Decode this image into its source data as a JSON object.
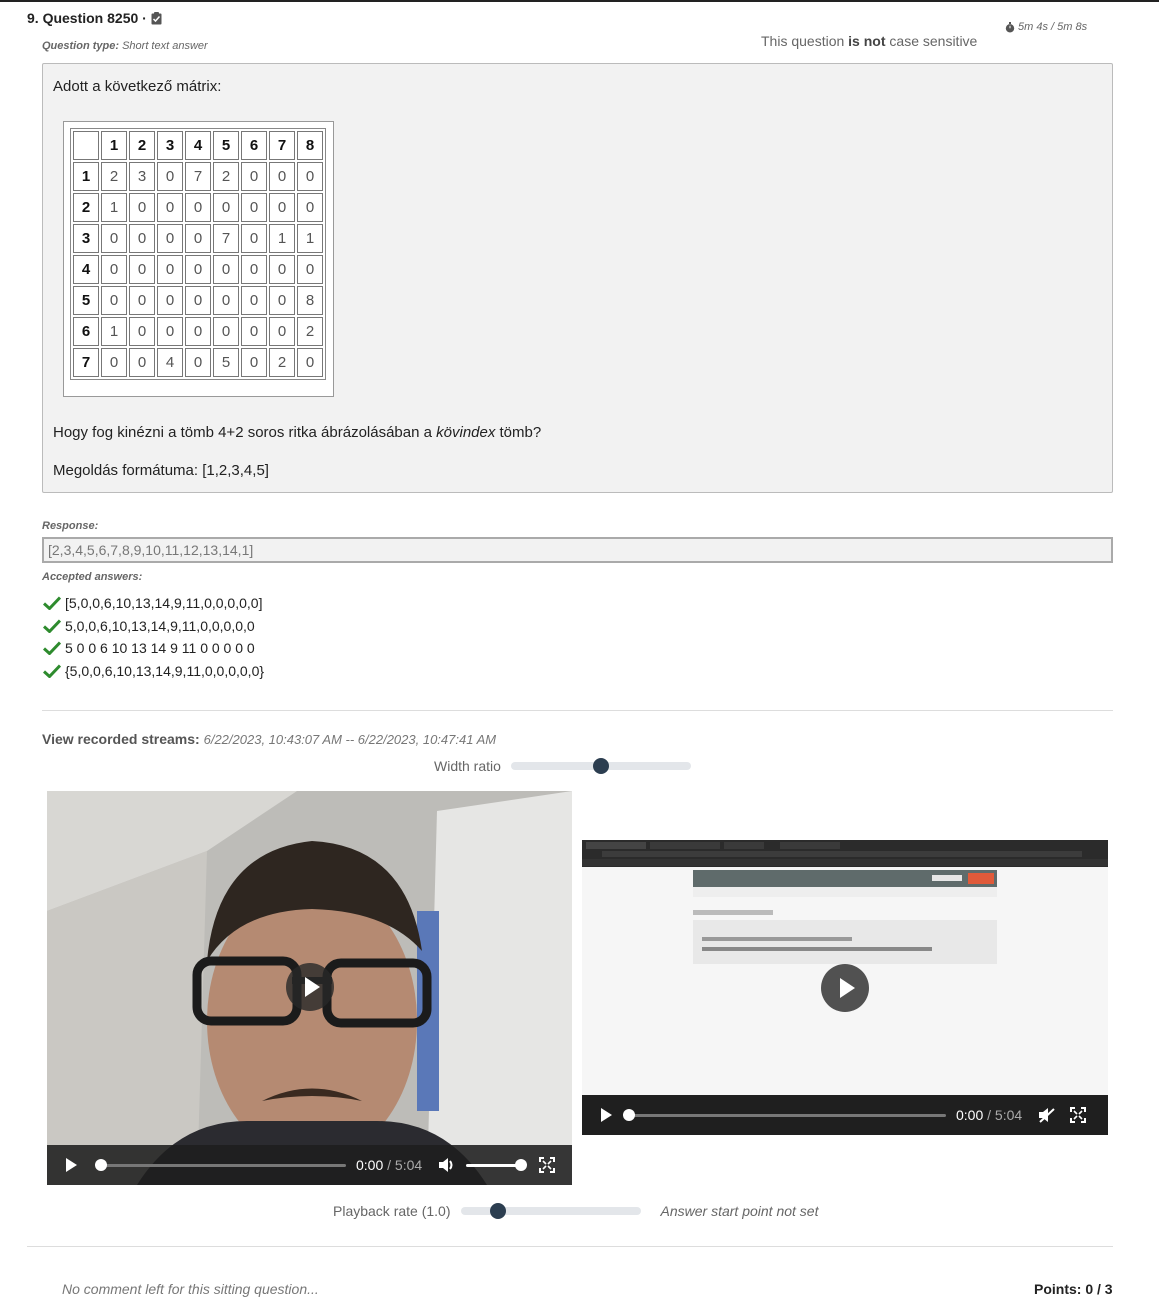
{
  "question": {
    "number_title": "9. Question 8250 ·",
    "type_label": "Question type:",
    "type_value": "Short text answer",
    "case_prefix": "This question",
    "case_strong": "is not",
    "case_suffix": "case sensitive",
    "timer": "5m 4s / 5m 8s",
    "intro": "Adott a következő mátrix:",
    "matrix": {
      "col_headers": [
        "",
        "1",
        "2",
        "3",
        "4",
        "5",
        "6",
        "7",
        "8"
      ],
      "rows": [
        [
          "1",
          "2",
          "3",
          "0",
          "7",
          "2",
          "0",
          "0",
          "0"
        ],
        [
          "2",
          "1",
          "0",
          "0",
          "0",
          "0",
          "0",
          "0",
          "0"
        ],
        [
          "3",
          "0",
          "0",
          "0",
          "0",
          "7",
          "0",
          "1",
          "1"
        ],
        [
          "4",
          "0",
          "0",
          "0",
          "0",
          "0",
          "0",
          "0",
          "0"
        ],
        [
          "5",
          "0",
          "0",
          "0",
          "0",
          "0",
          "0",
          "0",
          "8"
        ],
        [
          "6",
          "1",
          "0",
          "0",
          "0",
          "0",
          "0",
          "0",
          "2"
        ],
        [
          "7",
          "0",
          "0",
          "4",
          "0",
          "5",
          "0",
          "2",
          "0"
        ]
      ]
    },
    "prompt_before": "Hogy fog kinézni a tömb 4+2 soros ritka ábrázolásában a ",
    "prompt_em": "kövindex",
    "prompt_after": " tömb?",
    "format_line": "Megoldás formátuma: [1,2,3,4,5]"
  },
  "response": {
    "label": "Response:",
    "value": "[2,3,4,5,6,7,8,9,10,11,12,13,14,1]"
  },
  "accepted": {
    "label": "Accepted answers:",
    "items": [
      "[5,0,0,6,10,13,14,9,11,0,0,0,0,0]",
      "5,0,0,6,10,13,14,9,11,0,0,0,0,0",
      "5 0 0 6 10 13 14 9 11 0 0 0 0 0",
      "{5,0,0,6,10,13,14,9,11,0,0,0,0,0}"
    ],
    "check_color": "#2e8b2e"
  },
  "streams": {
    "label": "View recorded streams:",
    "range": "6/22/2023, 10:43:07 AM -- 6/22/2023, 10:47:41 AM",
    "width_ratio_label": "Width ratio",
    "width_ratio": 0.5,
    "video1": {
      "current": "0:00",
      "sep": " / ",
      "duration": "5:04",
      "volume": 1.0
    },
    "video2": {
      "current": "0:00",
      "sep": " / ",
      "duration": "5:04"
    },
    "playback_label": "Playback rate (1.0)",
    "playback_value": 0.18,
    "answer_start": "Answer start point not set"
  },
  "footer": {
    "comment": "No comment left for this sitting question...",
    "points": "Points: 0 / 3"
  },
  "colors": {
    "slider_thumb": "#2c3e50",
    "panel_bg": "#f2f2f2"
  }
}
